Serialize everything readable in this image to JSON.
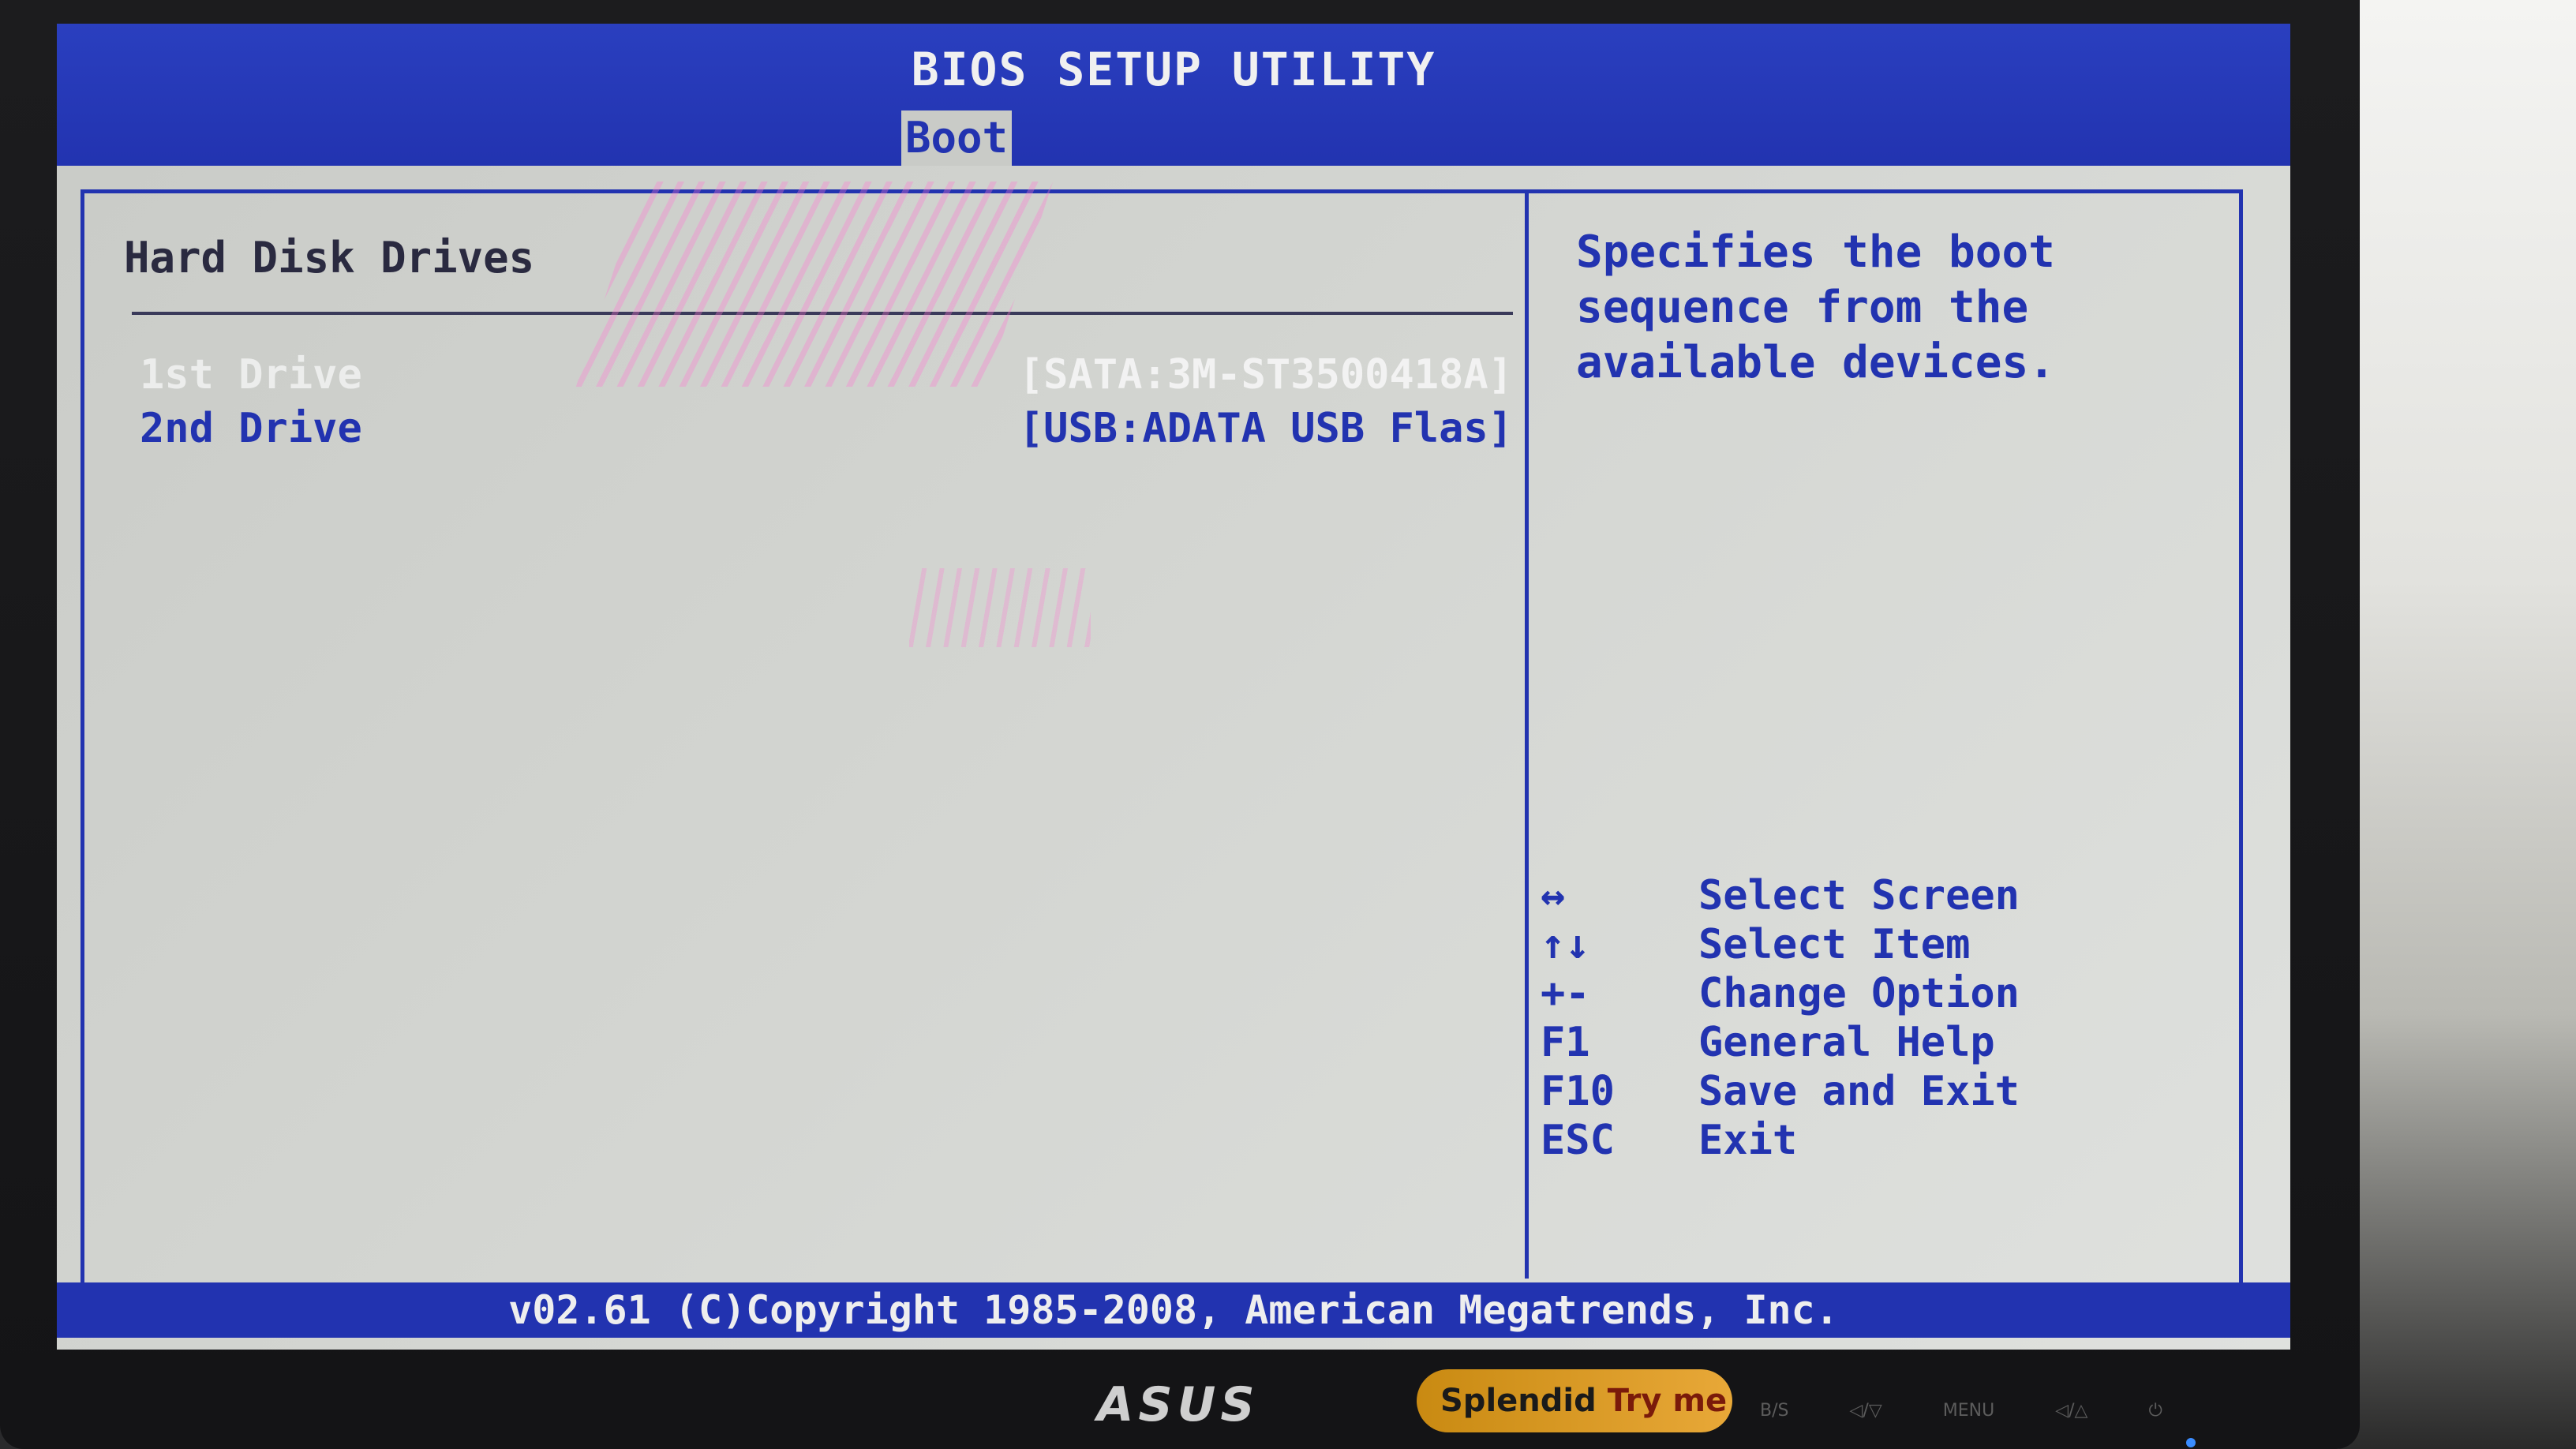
{
  "app": {
    "title": "BIOS SETUP UTILITY",
    "active_tab": "Boot"
  },
  "main": {
    "section_title": "Hard Disk Drives",
    "drives": [
      {
        "label": "1st Drive",
        "value": "[SATA:3M-ST3500418A]"
      },
      {
        "label": "2nd Drive",
        "value": "[USB:ADATA USB Flas]"
      }
    ]
  },
  "help": {
    "lines": [
      "Specifies the boot",
      "sequence from the",
      "available devices."
    ]
  },
  "keys": [
    {
      "key": "↔",
      "action": "Select Screen",
      "icon": "left-right-arrow-icon"
    },
    {
      "key": "↑↓",
      "action": "Select Item",
      "icon": "up-down-arrow-icon"
    },
    {
      "key": "+-",
      "action": "Change Option",
      "icon": "plus-minus-icon"
    },
    {
      "key": "F1",
      "action": "General Help"
    },
    {
      "key": "F10",
      "action": "Save and Exit"
    },
    {
      "key": "ESC",
      "action": "Exit"
    }
  ],
  "status": {
    "copyright": "v02.61 (C)Copyright 1985-2008, American Megatrends, Inc."
  },
  "monitor": {
    "brand": "ASUS",
    "badge_left": "Splendid",
    "badge_right": "Try me",
    "buttons": [
      "B/S",
      "◁/▽",
      "MENU",
      "◁/△",
      "⏻"
    ]
  },
  "colors": {
    "bios_blue": "#2233b0",
    "bios_background": "#c9cbc7",
    "highlight_text": "#f2f2f2"
  }
}
